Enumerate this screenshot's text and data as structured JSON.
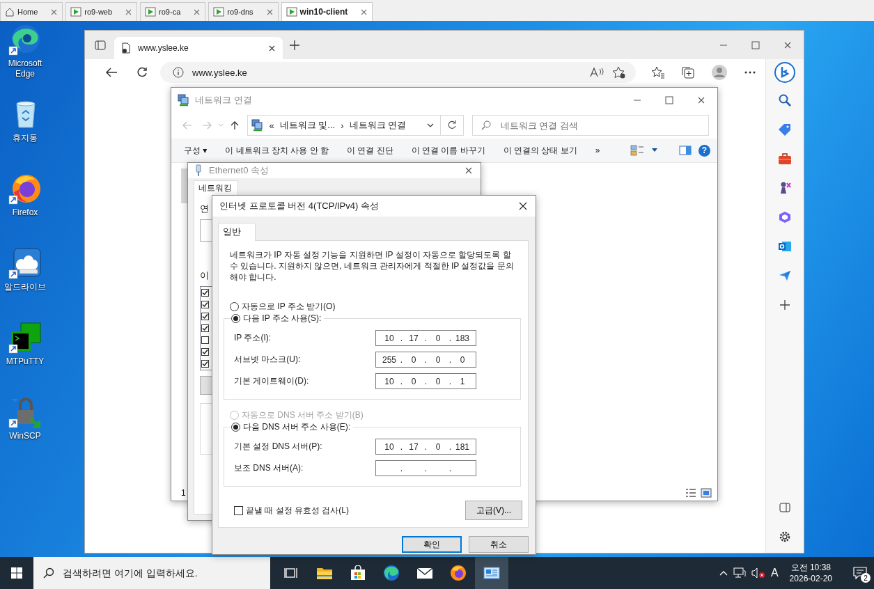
{
  "vm_tabs": [
    {
      "label": "Home",
      "kind": "home",
      "selected": false
    },
    {
      "label": "ro9-web",
      "kind": "vm",
      "selected": false
    },
    {
      "label": "ro9-ca",
      "kind": "vm",
      "selected": false
    },
    {
      "label": "ro9-dns",
      "kind": "vm",
      "selected": false
    },
    {
      "label": "win10-client",
      "kind": "vm",
      "selected": true
    }
  ],
  "desktop_icons": [
    {
      "label": "Microsoft Edge",
      "kind": "edge"
    },
    {
      "label": "휴지통",
      "kind": "recycle"
    },
    {
      "label": "Firefox",
      "kind": "firefox"
    },
    {
      "label": "알드라이브",
      "kind": "aldrive"
    },
    {
      "label": "MTPuTTY",
      "kind": "putty"
    },
    {
      "label": "WinSCP",
      "kind": "winscp"
    }
  ],
  "browser": {
    "tab_title": "www.yslee.ke",
    "address": "www.yslee.ke"
  },
  "network_window": {
    "title": "네트워크 연결",
    "breadcrumb": [
      "«",
      "네트워크 및...",
      "›",
      "네트워크 연결"
    ],
    "search": {
      "placeholder": "네트워크 연결 검색"
    },
    "toolbar": [
      "구성 ▾",
      "이 네트워크 장치 사용 안 함",
      "이 연결 진단",
      "이 연결 이름 바꾸기",
      "이 연결의 상태 보기",
      "»"
    ],
    "help": "?",
    "status": "1"
  },
  "ethernet_window": {
    "title": "Ethernet0 속성",
    "tabs": [
      {
        "label": "네트워킹",
        "selected": true
      }
    ],
    "connect_label": "연",
    "items_label": "이",
    "components": [
      {
        "checked": true
      },
      {
        "checked": true
      },
      {
        "checked": true
      },
      {
        "checked": true
      },
      {
        "checked": false
      },
      {
        "checked": true
      },
      {
        "checked": true
      }
    ]
  },
  "tcp_dialog": {
    "title": "인터넷 프로토콜 버전 4(TCP/IPv4) 속성",
    "tabs": [
      {
        "label": "일반",
        "selected": true
      }
    ],
    "description": "네트워크가 IP 자동 설정 기능을 지원하면 IP 설정이 자동으로 할당되도록 할 수 있습니다. 지원하지 않으면, 네트워크 관리자에게 적절한 IP 설정값을 문의해야 합니다.",
    "ip_section": {
      "options": [
        {
          "label": "자동으로 IP 주소 받기(O)",
          "selected": false,
          "disabled": false
        },
        {
          "label": "다음 IP 주소 사용(S):",
          "selected": true,
          "disabled": false
        }
      ],
      "fields": [
        {
          "label": "IP 주소(I):",
          "octets": [
            "10",
            "17",
            "0",
            "183"
          ],
          "separator": "."
        },
        {
          "label": "서브넷 마스크(U):",
          "octets": [
            "255",
            "0",
            "0",
            "0"
          ],
          "separator": "."
        },
        {
          "label": "기본 게이트웨이(D):",
          "octets": [
            "10",
            "0",
            "0",
            "1"
          ],
          "separator": "."
        }
      ]
    },
    "dns_section": {
      "options": [
        {
          "label": "자동으로 DNS 서버 주소 받기(B)",
          "selected": false,
          "disabled": true
        },
        {
          "label": "다음 DNS 서버 주소 사용(E):",
          "selected": true,
          "disabled": false
        }
      ],
      "fields": [
        {
          "label": "기본 설정 DNS 서버(P):",
          "octets": [
            "10",
            "17",
            "0",
            "181"
          ],
          "separator": "."
        },
        {
          "label": "보조 DNS 서버(A):",
          "separator": "."
        }
      ]
    },
    "validate": {
      "label": "끝낼 때 설정 유효성 검사(L)",
      "checked": false
    },
    "advanced_button": "고급(V)...",
    "buttons": [
      {
        "label": "확인",
        "kind": "default"
      },
      {
        "label": "취소",
        "kind": "normal"
      }
    ]
  },
  "taskbar": {
    "search": {
      "placeholder": "검색하려면 여기에 입력하세요."
    },
    "apps": [
      {
        "kind": "taskview",
        "selected": false
      },
      {
        "kind": "explorer",
        "selected": false
      },
      {
        "kind": "store",
        "selected": false
      },
      {
        "kind": "edge",
        "selected": false
      },
      {
        "kind": "mail",
        "selected": false
      },
      {
        "kind": "firefox",
        "selected": false
      },
      {
        "kind": "network",
        "selected": true
      }
    ],
    "ime": "A",
    "time": "오전 10:38",
    "date": "2026-02-20",
    "notification_count": "2"
  }
}
